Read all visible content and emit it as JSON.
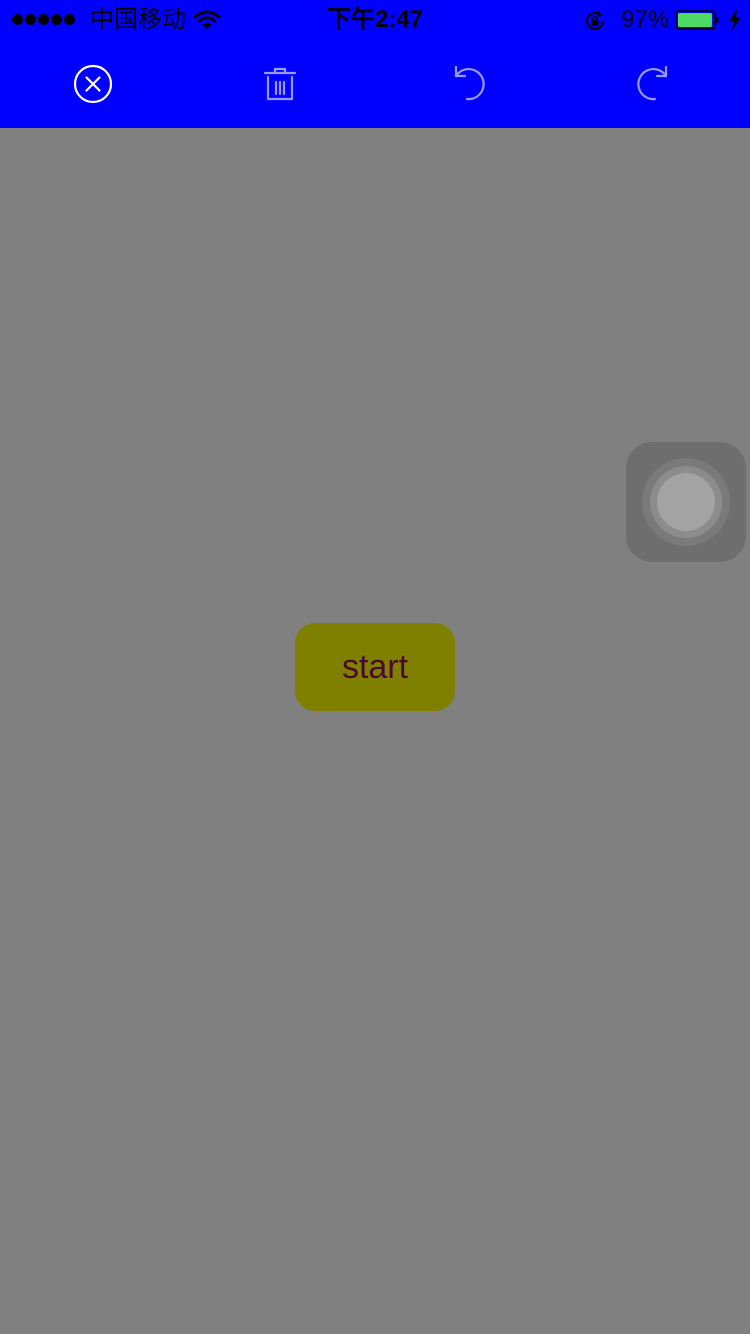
{
  "status_bar": {
    "carrier": "中国移动",
    "time": "下午2:47",
    "battery_percent": "97%",
    "battery_level": 0.97,
    "signal_bars": 5,
    "icons": [
      "signal-dots-icon",
      "wifi-icon",
      "rotation-lock-icon",
      "battery-icon",
      "charging-bolt-icon"
    ]
  },
  "toolbar": {
    "background_color": "#0000ff",
    "buttons": [
      {
        "name": "close",
        "icon": "close-circle-icon"
      },
      {
        "name": "delete",
        "icon": "trash-icon"
      },
      {
        "name": "undo",
        "icon": "undo-icon"
      },
      {
        "name": "redo",
        "icon": "redo-icon"
      }
    ]
  },
  "canvas": {
    "background_color": "#808080"
  },
  "start_button": {
    "label": "start",
    "background_color": "#808000",
    "text_color": "#4a0a2a"
  },
  "assistive_touch": {
    "icon": "assistive-touch-icon"
  }
}
